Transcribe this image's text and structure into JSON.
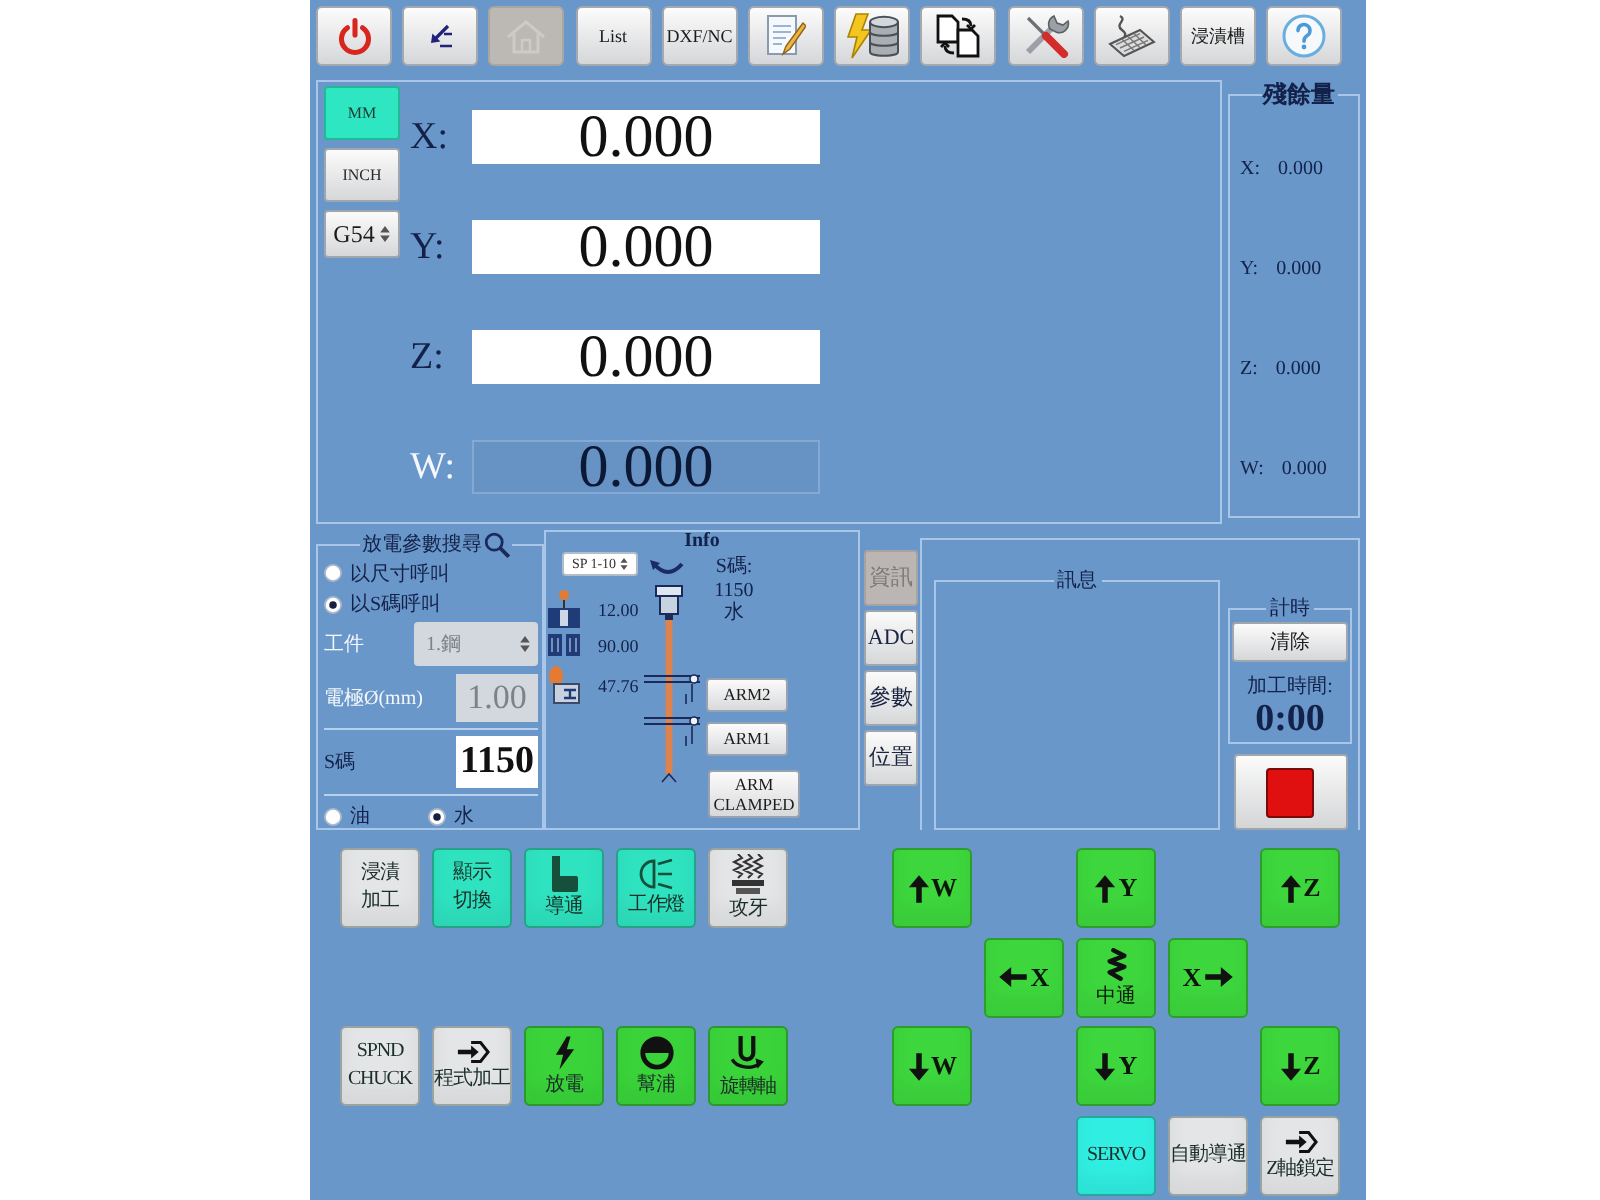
{
  "toolbar": [
    {
      "kind": "icon",
      "disabled": false
    },
    {
      "kind": "icon",
      "disabled": false
    },
    {
      "kind": "icon",
      "disabled": true
    },
    {
      "kind": "text",
      "label": "List",
      "disabled": false
    },
    {
      "kind": "text",
      "label": "DXF/NC",
      "disabled": false
    },
    {
      "kind": "icon",
      "disabled": false
    },
    {
      "kind": "icon",
      "disabled": false
    },
    {
      "kind": "icon",
      "disabled": false
    },
    {
      "kind": "icon",
      "disabled": false
    },
    {
      "kind": "icon",
      "disabled": false
    },
    {
      "kind": "text",
      "label": "浸漬槽",
      "disabled": false
    },
    {
      "kind": "icon",
      "disabled": false
    }
  ],
  "position": {
    "units": [
      {
        "label": "MM",
        "selected": true
      },
      {
        "label": "INCH",
        "selected": false
      }
    ],
    "offset": "G54",
    "axes": [
      {
        "label": "X:",
        "value": "0.000",
        "disabled": false
      },
      {
        "label": "Y:",
        "value": "0.000",
        "disabled": false
      },
      {
        "label": "Z:",
        "value": "0.000",
        "disabled": false
      },
      {
        "label": "W:",
        "value": "0.000",
        "disabled": true
      }
    ]
  },
  "remaining": {
    "title": "殘餘量",
    "axes": [
      {
        "label": "X:",
        "value": "0.000"
      },
      {
        "label": "Y:",
        "value": "0.000"
      },
      {
        "label": "Z:",
        "value": "0.000"
      },
      {
        "label": "W:",
        "value": "0.000"
      }
    ]
  },
  "parameter_search": {
    "title": "放電參數搜尋",
    "call_modes": [
      {
        "label": "以尺寸呼叫",
        "selected": false
      },
      {
        "label": "以S碼呼叫",
        "selected": true
      }
    ],
    "workpiece": {
      "label": "工件",
      "value": "1.鋼",
      "disabled": true
    },
    "electrode": {
      "label": "電極Ø(mm)",
      "value": "1.00",
      "disabled": true
    },
    "s_code": {
      "label": "S碼",
      "value": "1150",
      "disabled": false
    },
    "fluid": [
      {
        "label": "油",
        "selected": false
      },
      {
        "label": "水",
        "selected": true
      }
    ]
  },
  "info": {
    "title": "Info",
    "selector": "SP 1-10",
    "s_code_label": "S碼:",
    "s_code": "1150",
    "fluid": "水",
    "readings": [
      "12.00",
      "90.00",
      "47.76"
    ],
    "arm_buttons": [
      "ARM2",
      "ARM1",
      "ARM CLAMPED"
    ]
  },
  "side_tabs": [
    {
      "label": "資訊",
      "selected": true
    },
    {
      "label": "ADC",
      "selected": false
    },
    {
      "label": "參數",
      "selected": false
    },
    {
      "label": "位置",
      "selected": false
    }
  ],
  "messages": {
    "title": "訊息"
  },
  "timer": {
    "title": "計時",
    "clear_button": "清除",
    "label": "加工時間:",
    "value": "0:00"
  },
  "function_rows": [
    [
      {
        "kind": "text",
        "lines": [
          "浸漬",
          "加工"
        ],
        "color": "#e4e5e6"
      },
      {
        "kind": "text",
        "lines": [
          "顯示",
          "切換"
        ],
        "color": "#2fe3c0"
      },
      {
        "kind": "icon",
        "label": "導通",
        "color": "#2fe3c0"
      },
      {
        "kind": "icon",
        "label": "工作燈",
        "color": "#2fe3c0"
      },
      {
        "kind": "icon",
        "label": "攻牙",
        "color": "#e4e5e6"
      }
    ],
    [
      {
        "kind": "text",
        "lines": [
          "SPND",
          "CHUCK"
        ],
        "color": "#e4e5e6"
      },
      {
        "kind": "icon",
        "label": "程式加工",
        "color": "#e4e5e6"
      },
      {
        "kind": "icon",
        "label": "放電",
        "color": "#3ad43a"
      },
      {
        "kind": "icon",
        "label": "幫浦",
        "color": "#3ad43a"
      },
      {
        "kind": "icon",
        "label": "旋轉軸",
        "color": "#3ad43a"
      }
    ]
  ],
  "jog_buttons": [
    {
      "kind": "arrow",
      "label": "W"
    },
    {
      "kind": "arrow",
      "label": "Y"
    },
    {
      "kind": "arrow",
      "label": "Z"
    },
    {
      "kind": "arrow",
      "label": "X"
    },
    {
      "kind": "icon",
      "label": "中通"
    },
    {
      "kind": "arrow",
      "label": "X"
    },
    {
      "kind": "arrow",
      "label": "W"
    },
    {
      "kind": "arrow",
      "label": "Y"
    },
    {
      "kind": "arrow",
      "label": "Z"
    }
  ],
  "mode_buttons": [
    {
      "kind": "text",
      "lines": [
        "SERVO"
      ],
      "color": "#30efe2"
    },
    {
      "kind": "text",
      "lines": [
        "自動導通"
      ],
      "color": "#e4e5e6"
    },
    {
      "kind": "icon",
      "label": "Z軸鎖定",
      "color": "#e4e5e6"
    }
  ]
}
